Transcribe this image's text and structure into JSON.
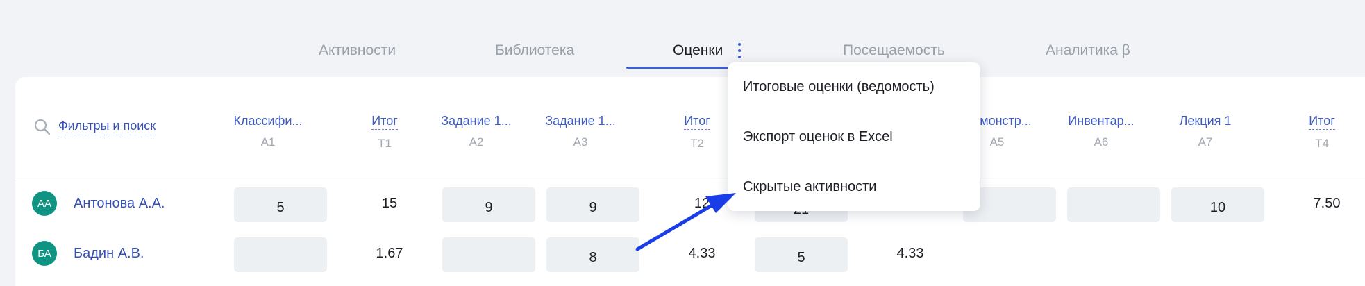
{
  "tabs": [
    {
      "label": "Активности"
    },
    {
      "label": "Библиотека"
    },
    {
      "label": "Оценки"
    },
    {
      "label": "Посещаемость"
    },
    {
      "label": "Аналитика β"
    }
  ],
  "active_tab": "Оценки",
  "search": {
    "label": "Фильтры и поиск",
    "icon": "search-icon"
  },
  "columns": [
    {
      "title": "Классифи...",
      "code": "A1",
      "total": false
    },
    {
      "title": "Итог",
      "code": "T1",
      "total": true
    },
    {
      "title": "Задание 1...",
      "code": "A2",
      "total": false
    },
    {
      "title": "Задание 1...",
      "code": "A3",
      "total": false
    },
    {
      "title": "Итог",
      "code": "T2",
      "total": true
    },
    {
      "title": "...емонстр...",
      "code": "A5",
      "total": false
    },
    {
      "title": "Инвентар...",
      "code": "A6",
      "total": false
    },
    {
      "title": "Лекция 1",
      "code": "A7",
      "total": false
    },
    {
      "title": "Итог",
      "code": "T4",
      "total": true
    }
  ],
  "students": [
    {
      "initials": "АА",
      "name": "Антонова А.А.",
      "a1": "5",
      "t1": "15",
      "a2": "9",
      "a3": "9",
      "t2_partial": "12",
      "hidden_partial": "21",
      "a5": "",
      "a6": "",
      "a7": "10",
      "t4": "7.50"
    },
    {
      "initials": "БА",
      "name": "Бадин А.В.",
      "a1": "",
      "t1": "1.67",
      "a2": "",
      "a3": "8",
      "t2": "4.33",
      "hidden": "5",
      "t3": "4.33"
    }
  ],
  "menu": {
    "items": [
      {
        "label": "Итоговые оценки (ведомость)"
      },
      {
        "label": "Экспорт оценок в Excel"
      },
      {
        "label": "Скрытые активности"
      }
    ]
  },
  "colors": {
    "accent": "#3b5fd9",
    "link": "#3550b8",
    "avatar": "#0f9483",
    "arrow": "#1a3de8",
    "cell_bg": "#edf0f3"
  }
}
